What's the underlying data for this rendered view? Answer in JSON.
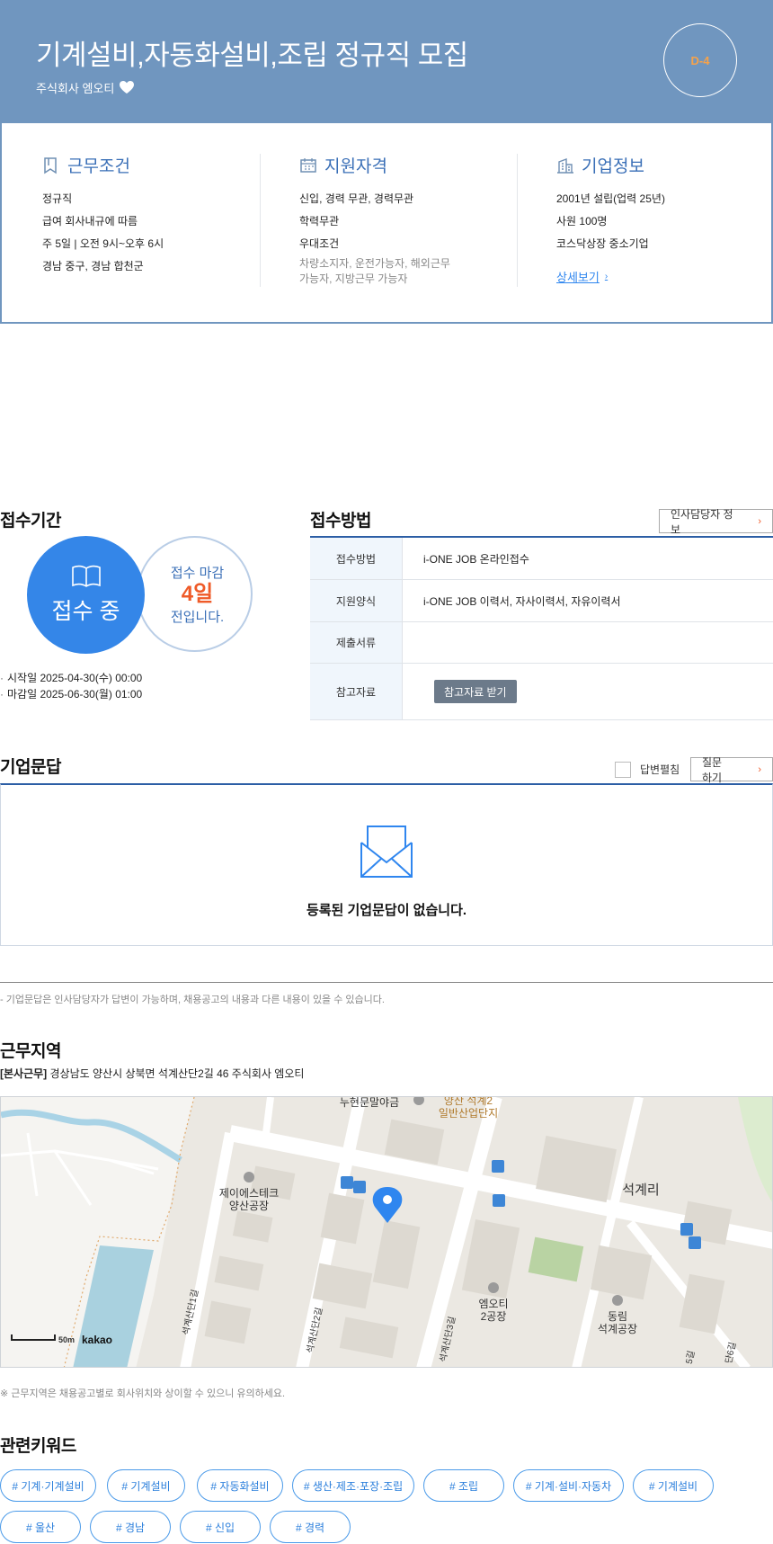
{
  "header": {
    "title": "기계설비,자동화설비,조립 정규직 모집",
    "company": "주식회사 엠오티",
    "dday": "D-4"
  },
  "summary": {
    "work": {
      "heading": "근무조건",
      "lines": [
        "정규직",
        "급여 회사내규에 따름",
        "주 5일 | 오전 9시~오후 6시",
        "경남 중구, 경남 합천군"
      ]
    },
    "qualification": {
      "heading": "지원자격",
      "lines": [
        "신입, 경력 무관, 경력무관",
        "학력무관",
        "우대조건"
      ],
      "sub": "차량소지자, 운전가능자, 해외근무 가능자, 지방근무 가능자"
    },
    "company_info": {
      "heading": "기업정보",
      "lines": [
        "2001년 설립(업력 25년)",
        "사원 100명",
        "코스닥상장 중소기업"
      ],
      "detail_link": "상세보기"
    }
  },
  "period": {
    "title": "접수기간",
    "status": "접수 중",
    "deadline_label": "접수 마감",
    "days_left": "4일",
    "deadline_suffix": "전입니다.",
    "start": "시작일 2025-04-30(수) 00:00",
    "end": "마감일 2025-06-30(월) 01:00"
  },
  "method": {
    "title": "접수방법",
    "hr_button": "인사담당자 정보",
    "rows": [
      {
        "label": "접수방법",
        "value": "i-ONE JOB 온라인접수"
      },
      {
        "label": "지원양식",
        "value": "i-ONE JOB 이력서, 자사이력서, 자유이력서"
      },
      {
        "label": "제출서류",
        "value": ""
      },
      {
        "label": "참고자료",
        "button": "참고자료 받기"
      }
    ]
  },
  "qa": {
    "title": "기업문답",
    "checkbox_label": "답변펼침",
    "ask_button": "질문하기",
    "empty": "등록된 기업문답이 없습니다.",
    "note": "- 기업문답은 인사담당자가 답변이 가능하며, 채용공고의 내용과 다른 내용이 있을 수 있습니다."
  },
  "location": {
    "title": "근무지역",
    "tag": "[본사근무]",
    "address": "경상남도 양산시 상북면 석계산단2길 46 주식회사 엠오티",
    "note": "※ 근무지역은 채용공고별로 회사위치와 상이할 수 있으니 유의하세요.",
    "map": {
      "labels": {
        "top": "누현문말야금",
        "industrial": "양산 석계2 일반산업단지",
        "jstech": "제이에스테크 양산공장",
        "seokgye": "석계리",
        "mot": "엠오티 2공장",
        "dongrim": "동림 석계공장",
        "road1": "석계산단1길",
        "road2": "석계산단2길",
        "road3": "석계산단3길",
        "road5": "5길",
        "road6": "단6길",
        "scale": "50m",
        "brand": "kakao"
      }
    }
  },
  "keywords": {
    "title": "관련키워드",
    "items": [
      "# 기계·기계설비",
      "# 기계설비",
      "# 자동화설비",
      "# 생산·제조·포장·조립",
      "# 조립",
      "# 기계·설비·자동차",
      "# 기계설비",
      "# 울산",
      "# 경남",
      "# 신입",
      "# 경력"
    ]
  },
  "colors": {
    "header_bg": "#7096bf",
    "accent_blue": "#3486e8",
    "deadline_orange": "#ef5a28",
    "table_border": "#2c5ea5"
  }
}
